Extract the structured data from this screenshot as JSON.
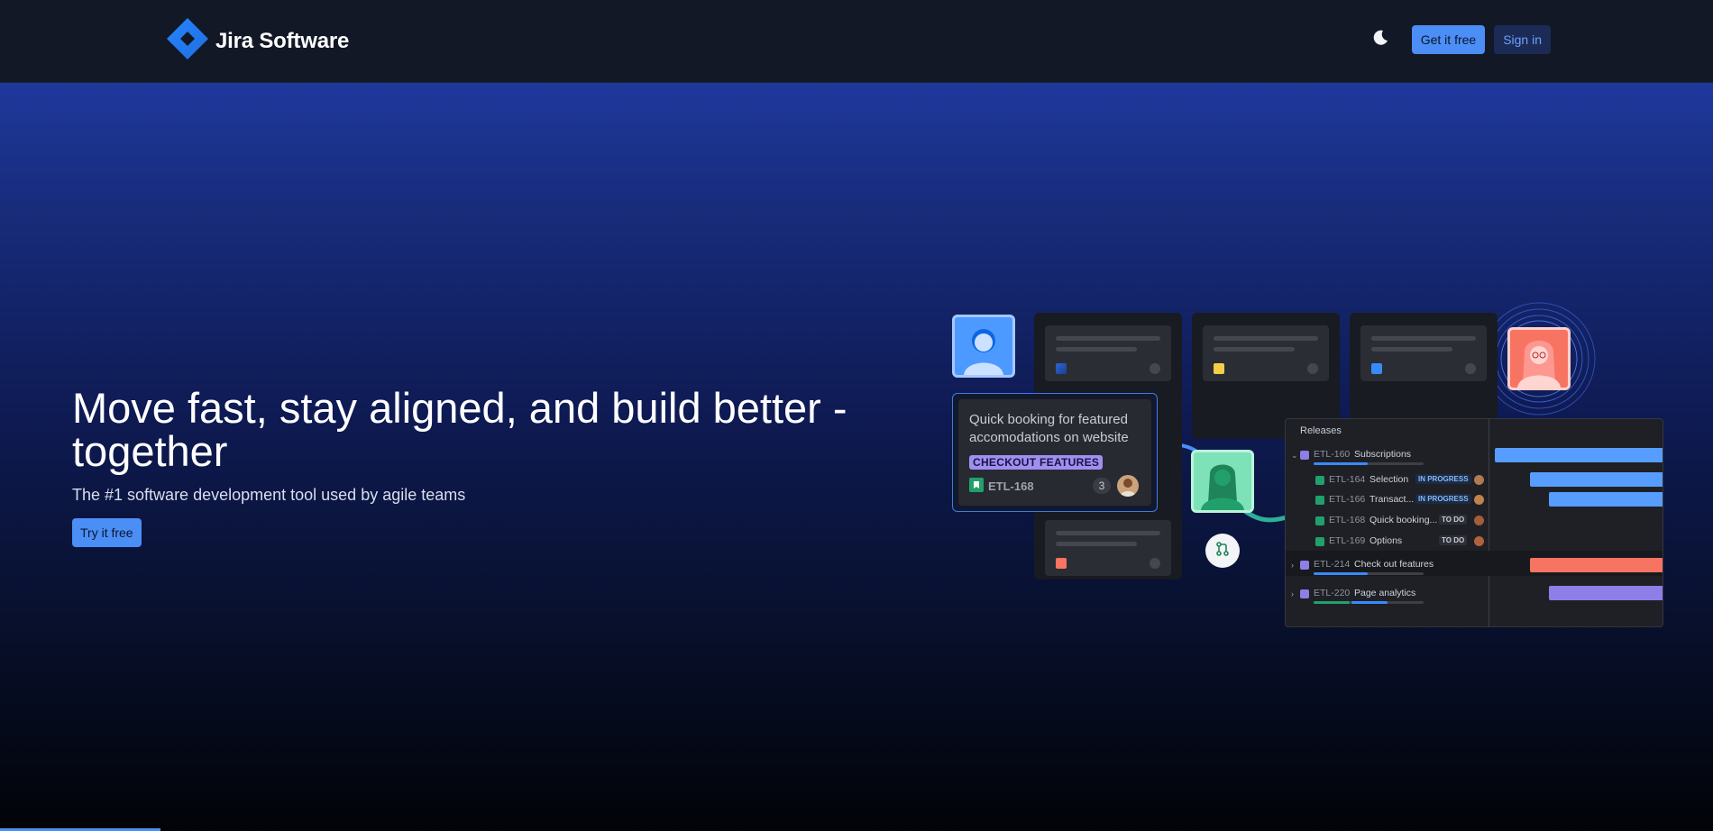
{
  "header": {
    "brand": "Jira Software",
    "theme_toggle_icon": "moon-icon",
    "get_it_free_label": "Get it free",
    "sign_in_label": "Sign in"
  },
  "hero": {
    "title": "Move fast, stay aligned, and build better - together",
    "subtitle": "The #1 software development tool used by agile teams",
    "cta_label": "Try it free"
  },
  "illustration": {
    "story_card": {
      "title": "Quick booking for featured accomodations on website",
      "tag": "CHECKOUT FEATURES",
      "key": "ETL-168",
      "count": "3"
    },
    "releases": {
      "title": "Releases",
      "rows": [
        {
          "key": "ETL-160",
          "name": "Subscriptions",
          "status": ""
        },
        {
          "key": "ETL-164",
          "name": "Selection",
          "status": "IN PROGRESS"
        },
        {
          "key": "ETL-166",
          "name": "Transact...",
          "status": "IN PROGRESS"
        },
        {
          "key": "ETL-168",
          "name": "Quick booking...",
          "status": "TO DO"
        },
        {
          "key": "ETL-169",
          "name": "Options",
          "status": "TO DO"
        },
        {
          "key": "ETL-214",
          "name": "Check out features",
          "status": ""
        },
        {
          "key": "ETL-220",
          "name": "Page analytics",
          "status": ""
        }
      ]
    }
  },
  "colors": {
    "accent": "#4b8ef5",
    "header_bg": "#121826",
    "tag_purple": "#9f8fef",
    "bar_blue": "#579dff",
    "bar_red": "#f87462",
    "bar_purple": "#8f7ee7",
    "square_yellow": "#f5cd47",
    "square_red": "#f87462"
  }
}
